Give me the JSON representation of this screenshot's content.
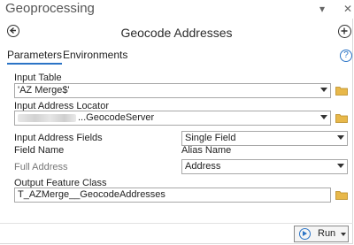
{
  "window": {
    "title": "Geoprocessing",
    "pin_icon": "pin-icon",
    "menu_icon": "chevron-down-icon",
    "close_icon": "close-icon"
  },
  "tool": {
    "title": "Geocode Addresses"
  },
  "tabs": {
    "parameters": "Parameters",
    "environments": "Environments",
    "help_symbol": "?"
  },
  "fields": {
    "input_table_label": "Input Table",
    "input_table_value": "'AZ Merge$'",
    "locator_label": "Input Address Locator",
    "locator_value": "GeocodeServer",
    "locator_value_prefix": "...",
    "address_fields_label": "Input Address Fields",
    "address_fields_value": "Single Field",
    "field_name_header": "Field Name",
    "alias_name_header": "Alias Name",
    "full_address_label": "Full Address",
    "full_address_value": "Address",
    "output_label": "Output Feature Class",
    "output_value": "T_AZMerge__GeocodeAddresses"
  },
  "footer": {
    "run_label": "Run"
  },
  "colors": {
    "accent": "#2b74c6",
    "folder": "#e8b84a"
  }
}
